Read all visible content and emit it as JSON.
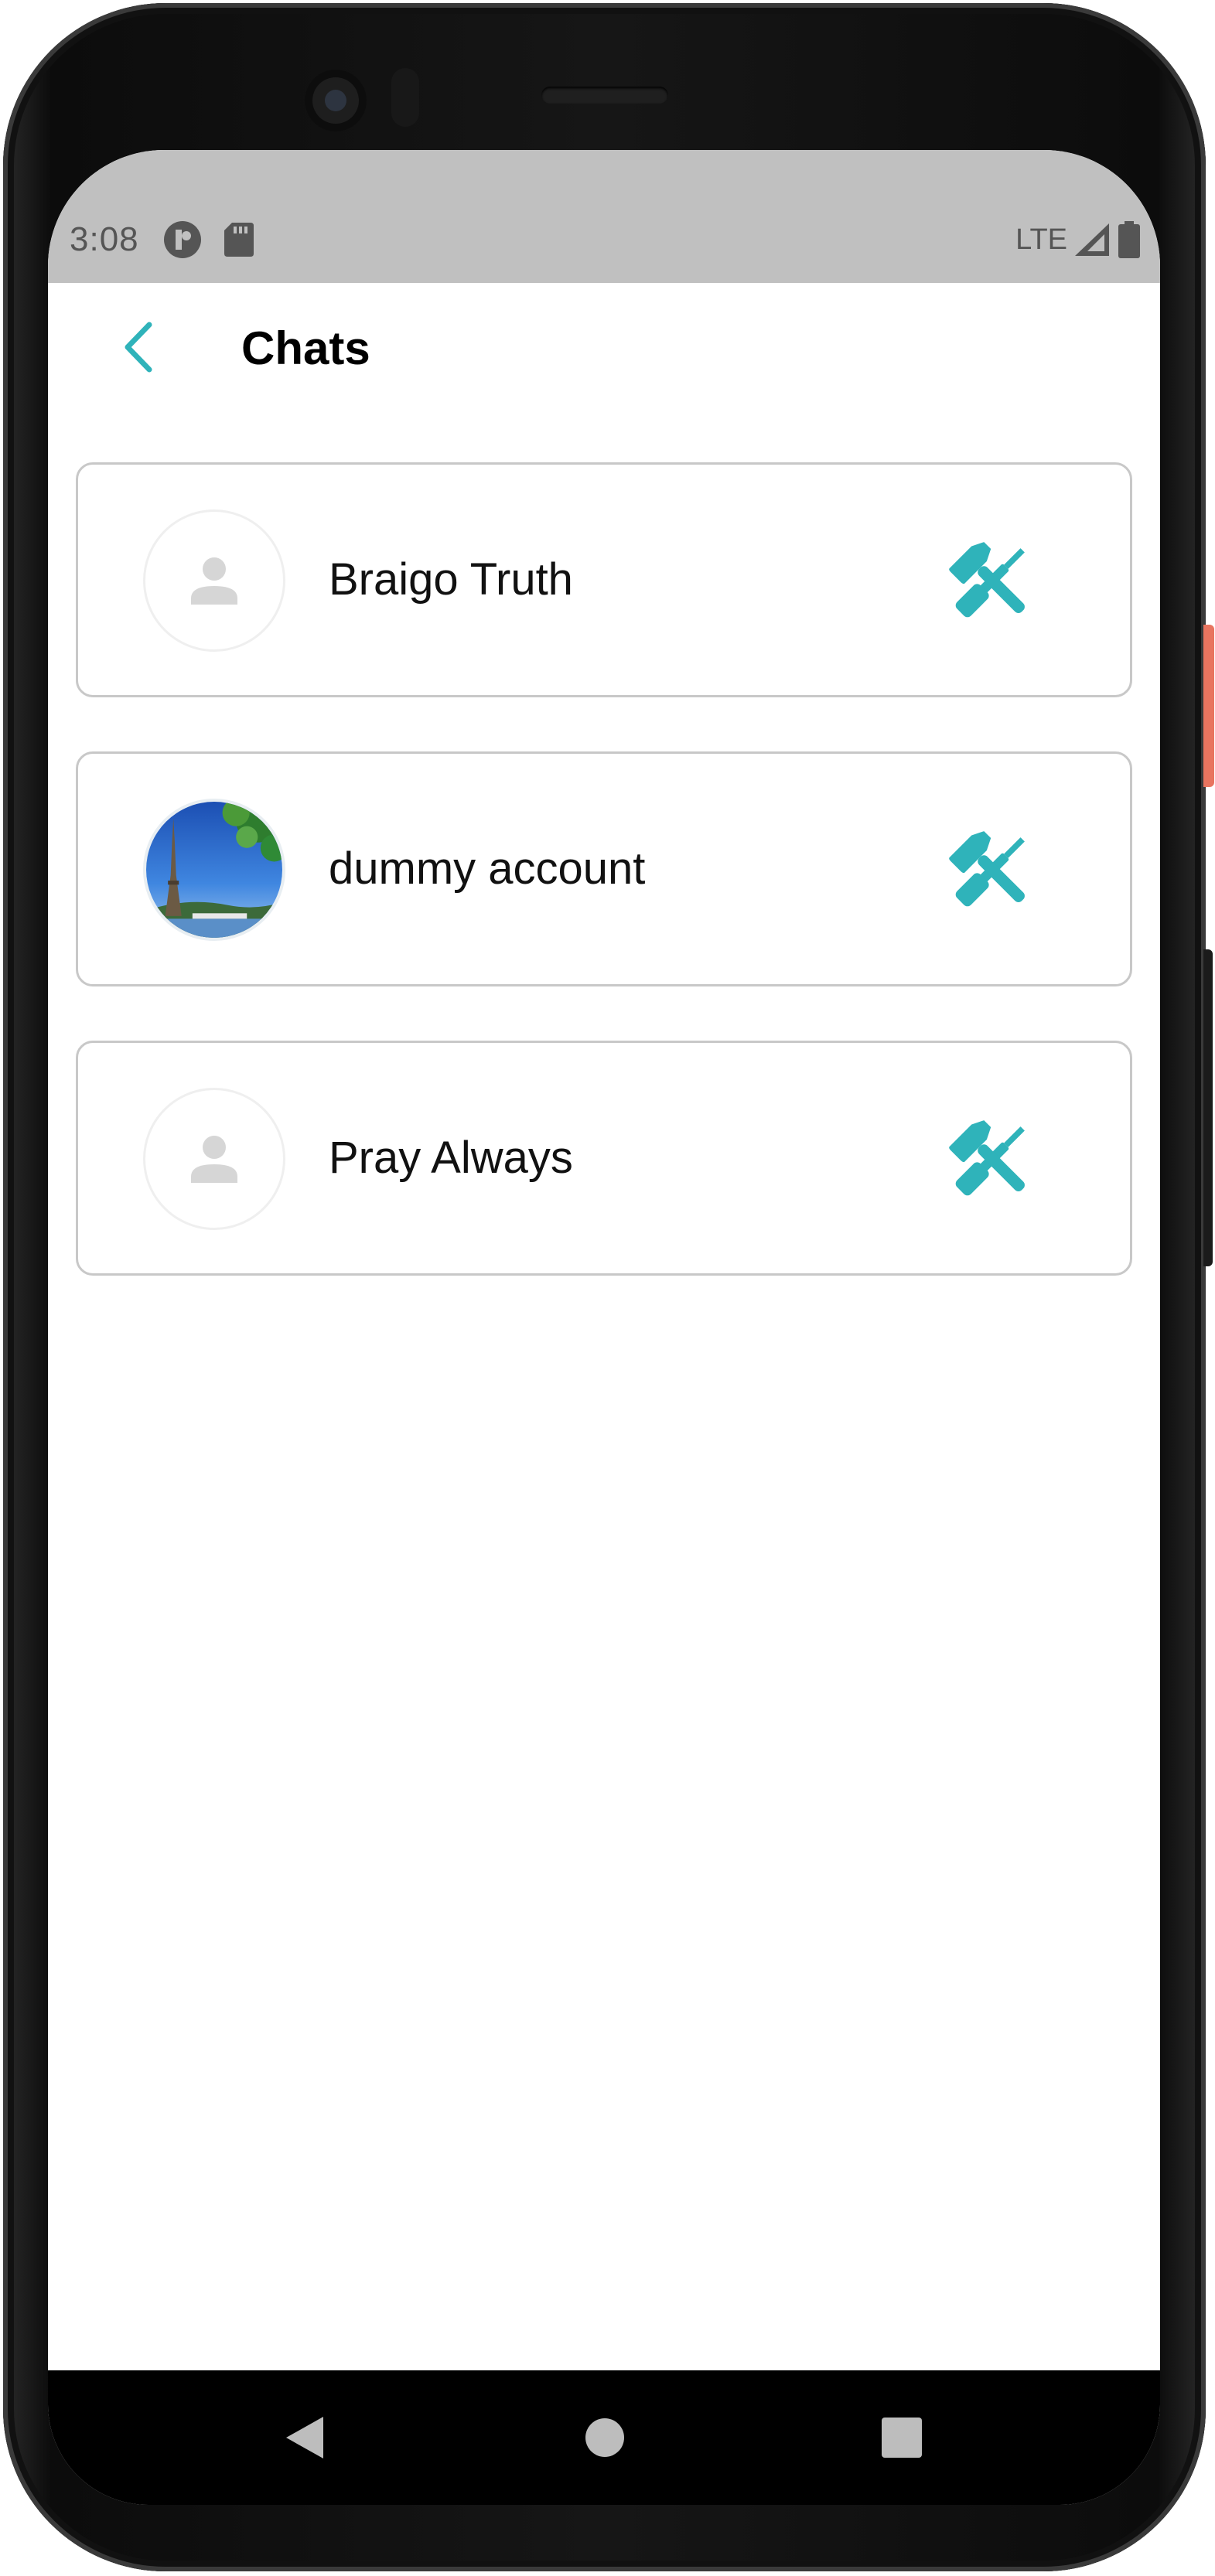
{
  "status_bar": {
    "time": "3:08",
    "network": "LTE",
    "icons": [
      "update-notification-icon",
      "sd-card-icon",
      "signal-icon",
      "battery-icon"
    ]
  },
  "header": {
    "title": "Chats",
    "back_icon": "chevron-left-icon"
  },
  "chats": [
    {
      "name": "Braigo Truth",
      "avatar": "default-person-icon",
      "action_icon": "hammer-screwdriver-icon"
    },
    {
      "name": "dummy account",
      "avatar": "eiffel-tower-photo",
      "action_icon": "hammer-screwdriver-icon"
    },
    {
      "name": "Pray Always",
      "avatar": "default-person-icon",
      "action_icon": "hammer-screwdriver-icon"
    }
  ],
  "navigation_bar": {
    "buttons": [
      "back-triangle-icon",
      "home-circle-icon",
      "recents-square-icon"
    ]
  },
  "colors": {
    "accent": "#2fb3ba",
    "status_bar_bg": "#c0c0c0",
    "card_border": "#c8c8c8",
    "placeholder_person": "#d6d6d6"
  }
}
